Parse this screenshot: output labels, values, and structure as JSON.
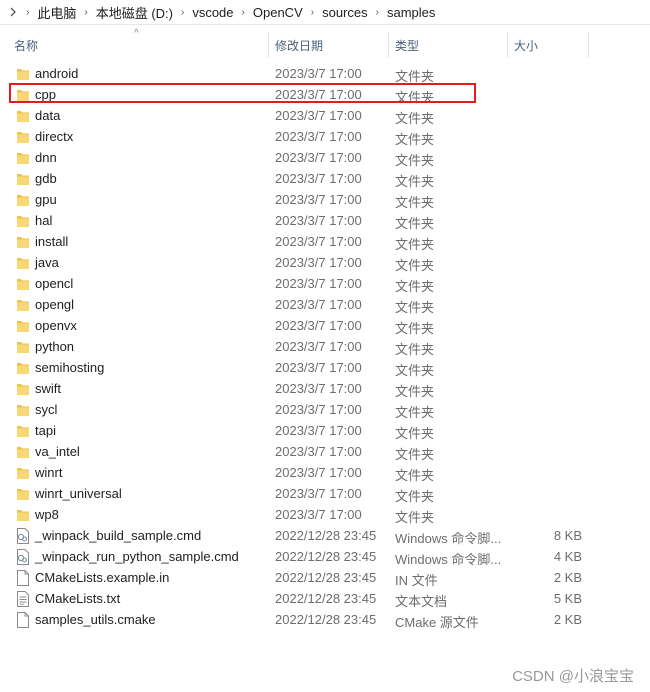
{
  "breadcrumb": [
    {
      "label": "此电脑"
    },
    {
      "label": "本地磁盘 (D:)"
    },
    {
      "label": "vscode"
    },
    {
      "label": "OpenCV"
    },
    {
      "label": "sources"
    },
    {
      "label": "samples"
    }
  ],
  "header": {
    "name": "名称",
    "date": "修改日期",
    "type": "类型",
    "size": "大小"
  },
  "files": [
    {
      "name": "android",
      "date": "2023/3/7 17:00",
      "type": "文件夹",
      "size": "",
      "icon": "folder-icon"
    },
    {
      "name": "cpp",
      "date": "2023/3/7 17:00",
      "type": "文件夹",
      "size": "",
      "icon": "folder-icon"
    },
    {
      "name": "data",
      "date": "2023/3/7 17:00",
      "type": "文件夹",
      "size": "",
      "icon": "folder-icon"
    },
    {
      "name": "directx",
      "date": "2023/3/7 17:00",
      "type": "文件夹",
      "size": "",
      "icon": "folder-icon"
    },
    {
      "name": "dnn",
      "date": "2023/3/7 17:00",
      "type": "文件夹",
      "size": "",
      "icon": "folder-icon"
    },
    {
      "name": "gdb",
      "date": "2023/3/7 17:00",
      "type": "文件夹",
      "size": "",
      "icon": "folder-icon"
    },
    {
      "name": "gpu",
      "date": "2023/3/7 17:00",
      "type": "文件夹",
      "size": "",
      "icon": "folder-icon"
    },
    {
      "name": "hal",
      "date": "2023/3/7 17:00",
      "type": "文件夹",
      "size": "",
      "icon": "folder-icon"
    },
    {
      "name": "install",
      "date": "2023/3/7 17:00",
      "type": "文件夹",
      "size": "",
      "icon": "folder-icon"
    },
    {
      "name": "java",
      "date": "2023/3/7 17:00",
      "type": "文件夹",
      "size": "",
      "icon": "folder-icon"
    },
    {
      "name": "opencl",
      "date": "2023/3/7 17:00",
      "type": "文件夹",
      "size": "",
      "icon": "folder-icon"
    },
    {
      "name": "opengl",
      "date": "2023/3/7 17:00",
      "type": "文件夹",
      "size": "",
      "icon": "folder-icon"
    },
    {
      "name": "openvx",
      "date": "2023/3/7 17:00",
      "type": "文件夹",
      "size": "",
      "icon": "folder-icon"
    },
    {
      "name": "python",
      "date": "2023/3/7 17:00",
      "type": "文件夹",
      "size": "",
      "icon": "folder-icon"
    },
    {
      "name": "semihosting",
      "date": "2023/3/7 17:00",
      "type": "文件夹",
      "size": "",
      "icon": "folder-icon"
    },
    {
      "name": "swift",
      "date": "2023/3/7 17:00",
      "type": "文件夹",
      "size": "",
      "icon": "folder-icon"
    },
    {
      "name": "sycl",
      "date": "2023/3/7 17:00",
      "type": "文件夹",
      "size": "",
      "icon": "folder-icon"
    },
    {
      "name": "tapi",
      "date": "2023/3/7 17:00",
      "type": "文件夹",
      "size": "",
      "icon": "folder-icon"
    },
    {
      "name": "va_intel",
      "date": "2023/3/7 17:00",
      "type": "文件夹",
      "size": "",
      "icon": "folder-icon"
    },
    {
      "name": "winrt",
      "date": "2023/3/7 17:00",
      "type": "文件夹",
      "size": "",
      "icon": "folder-icon"
    },
    {
      "name": "winrt_universal",
      "date": "2023/3/7 17:00",
      "type": "文件夹",
      "size": "",
      "icon": "folder-icon"
    },
    {
      "name": "wp8",
      "date": "2023/3/7 17:00",
      "type": "文件夹",
      "size": "",
      "icon": "folder-icon"
    },
    {
      "name": "_winpack_build_sample.cmd",
      "date": "2022/12/28 23:45",
      "type": "Windows 命令脚...",
      "size": "8 KB",
      "icon": "cmd-file-icon"
    },
    {
      "name": "_winpack_run_python_sample.cmd",
      "date": "2022/12/28 23:45",
      "type": "Windows 命令脚...",
      "size": "4 KB",
      "icon": "cmd-file-icon"
    },
    {
      "name": "CMakeLists.example.in",
      "date": "2022/12/28 23:45",
      "type": "IN 文件",
      "size": "2 KB",
      "icon": "blank-file-icon"
    },
    {
      "name": "CMakeLists.txt",
      "date": "2022/12/28 23:45",
      "type": "文本文档",
      "size": "5 KB",
      "icon": "text-file-icon"
    },
    {
      "name": "samples_utils.cmake",
      "date": "2022/12/28 23:45",
      "type": "CMake 源文件",
      "size": "2 KB",
      "icon": "blank-file-icon"
    }
  ],
  "watermark": "CSDN @小浪宝宝",
  "colors": {
    "folder": "#f0c24a",
    "highlight_border": "#e21b1b",
    "header_text": "#4c607a"
  }
}
